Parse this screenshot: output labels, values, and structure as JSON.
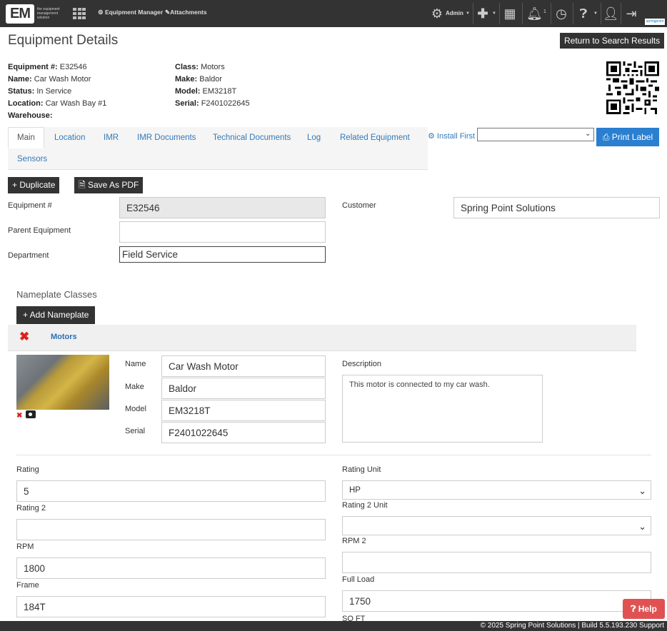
{
  "nav": {
    "logo_text": "EM",
    "logo_tagline": "the equipment management solution",
    "equipment_manager": "Equipment Manager",
    "attachments": "Attachments",
    "admin": "Admin",
    "notifications_count": "1",
    "brand_tag": "springpoint"
  },
  "header": {
    "title": "Equipment Details",
    "return_btn": "Return to Search Results"
  },
  "info": {
    "equipment_no_label": "Equipment #:",
    "equipment_no": "E32546",
    "name_label": "Name:",
    "name": "Car Wash Motor",
    "status_label": "Status:",
    "status": "In Service",
    "location_label": "Location:",
    "location": "Car Wash Bay #1",
    "warehouse_label": "Warehouse:",
    "warehouse": "",
    "class_label": "Class:",
    "class": "Motors",
    "make_label": "Make:",
    "make": "Baldor",
    "model_label": "Model:",
    "model": "EM3218T",
    "serial_label": "Serial:",
    "serial": "F2401022645"
  },
  "tabs": [
    "Main",
    "Location",
    "IMR",
    "IMR Documents",
    "Technical Documents",
    "Log",
    "Related Equipment",
    "Sensors"
  ],
  "actions": {
    "install_first": "Install First",
    "print_label": "Print Label",
    "duplicate": "+ Duplicate",
    "save_pdf": "Save As PDF"
  },
  "form": {
    "equipment_no_label": "Equipment #",
    "equipment_no": "E32546",
    "parent_label": "Parent Equipment",
    "parent": "",
    "department_label": "Department",
    "department": "Field Service",
    "customer_label": "Customer",
    "customer": "Spring Point Solutions"
  },
  "nameplate": {
    "section_title": "Nameplate Classes",
    "add_btn": "+ Add Nameplate",
    "class_link": "Motors",
    "name_label": "Name",
    "name": "Car Wash Motor",
    "make_label": "Make",
    "make": "Baldor",
    "model_label": "Model",
    "model": "EM3218T",
    "serial_label": "Serial",
    "serial": "F2401022645",
    "description_label": "Description",
    "description": "This motor is connected to my car wash."
  },
  "specs": {
    "rating_label": "Rating",
    "rating": "5",
    "rating_unit_label": "Rating Unit",
    "rating_unit": "HP",
    "rating2_label": "Rating 2",
    "rating2": "",
    "rating2_unit_label": "Rating 2 Unit",
    "rating2_unit": "",
    "rpm_label": "RPM",
    "rpm": "1800",
    "rpm2_label": "RPM 2",
    "rpm2": "",
    "frame_label": "Frame",
    "frame": "184T",
    "full_load_label": "Full Load",
    "full_load": "1750",
    "sqft_label": "SQ FT"
  },
  "help": "Help",
  "footer": "© 2025 Spring Point Solutions | Build 5.5.193.230 Support"
}
